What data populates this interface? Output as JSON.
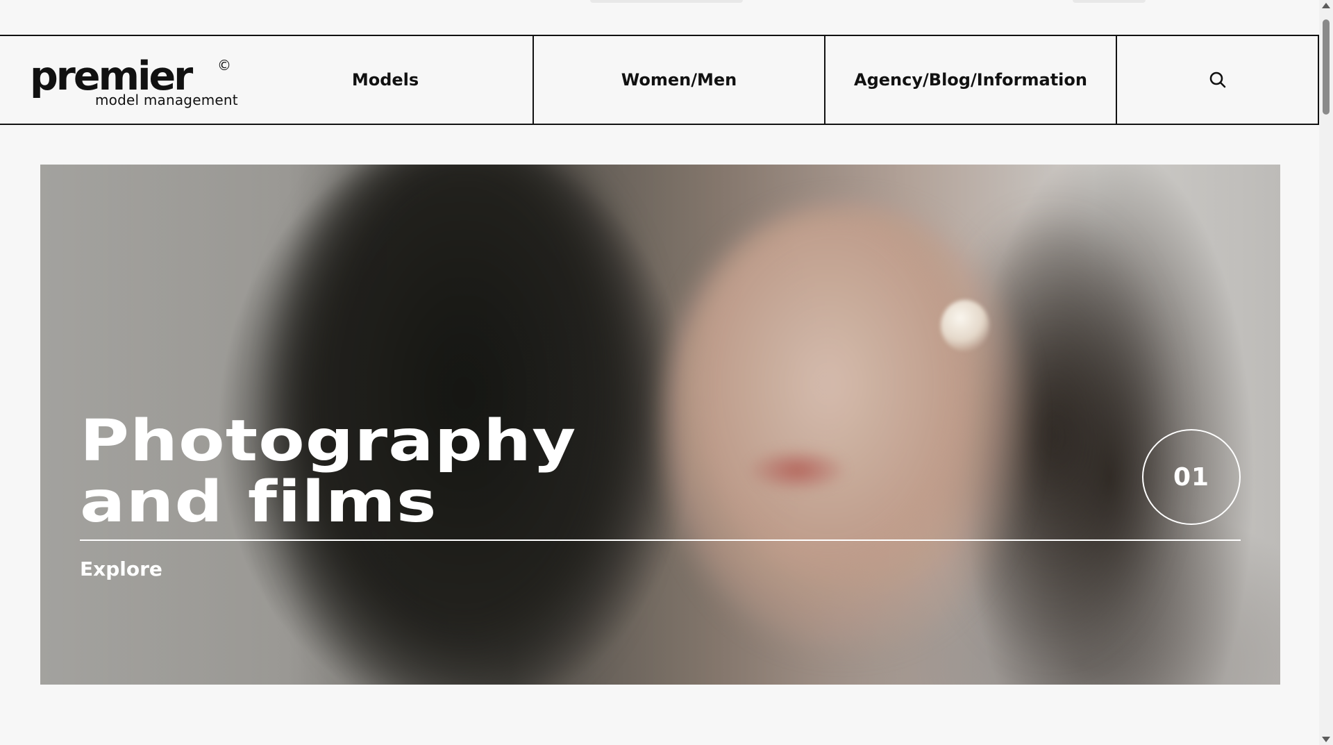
{
  "header": {
    "logo": {
      "word": "premier",
      "copyright": "©",
      "subtitle": "model management"
    },
    "nav": [
      {
        "label": "Models"
      },
      {
        "label": "Women/Men"
      },
      {
        "label": "Agency/Blog/Information"
      }
    ],
    "search_icon": "search-icon"
  },
  "hero": {
    "title": "Photography\nand films",
    "cta": "Explore",
    "index": "01",
    "image": "blurred portrait of woman with dark wavy hair and pearl earring"
  },
  "colors": {
    "background": "#f7f7f7",
    "text": "#111111",
    "hero_text": "#ffffff"
  }
}
